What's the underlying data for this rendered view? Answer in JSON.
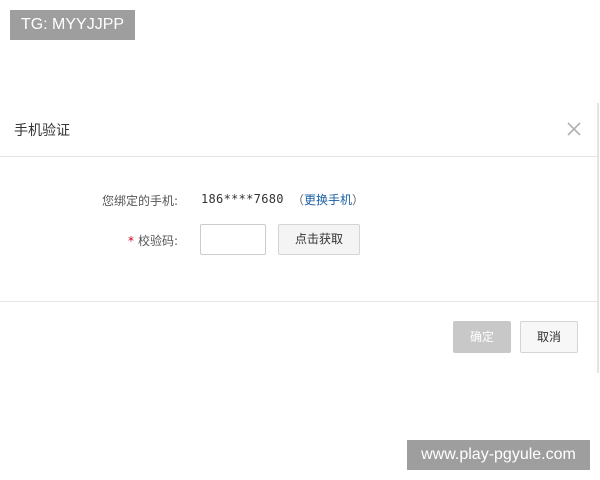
{
  "watermarks": {
    "top": "TG: MYYJJPP",
    "bottom": "www.play-pgyule.com"
  },
  "dialog": {
    "title": "手机验证",
    "close_icon": "close-icon",
    "phone_row": {
      "label": "您绑定的手机:",
      "value": "186****7680",
      "change_prefix": "（",
      "change_link": "更换手机",
      "change_suffix": "）"
    },
    "code_row": {
      "required_mark": "*",
      "label": "校验码:",
      "input_value": "",
      "get_code_label": "点击获取"
    },
    "footer": {
      "confirm_label": "确定",
      "cancel_label": "取消"
    }
  },
  "colors": {
    "link": "#1a5fa8",
    "required": "#d0021b",
    "confirm_disabled": "#c8c8c8",
    "watermark_bg": "#9e9e9e"
  }
}
